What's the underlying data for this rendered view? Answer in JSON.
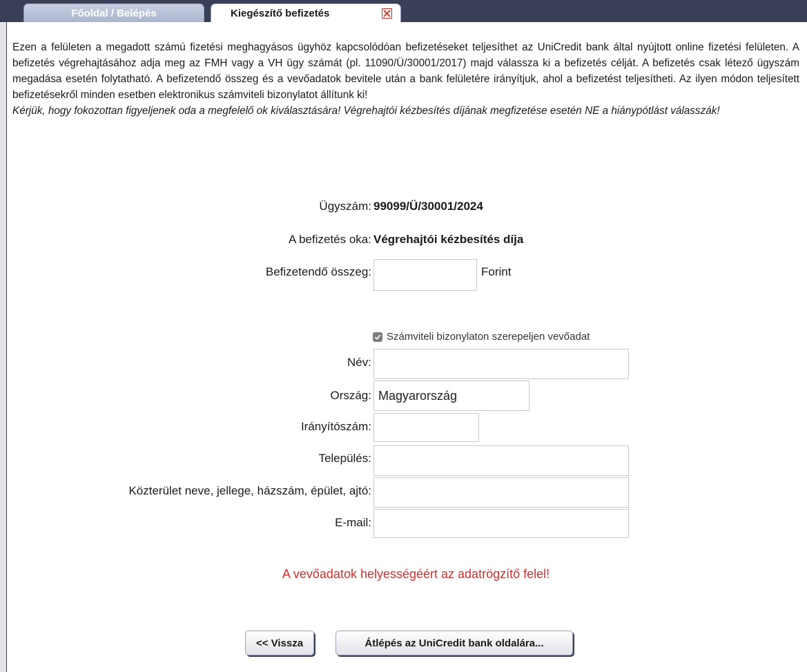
{
  "tabs": [
    {
      "label": "Főoldal / Belépés",
      "active": false
    },
    {
      "label": "Kiegészítő befizetés",
      "active": true
    }
  ],
  "intro": {
    "paragraph": "Ezen a felületen a megadott számú fizetési meghagyásos ügyhöz kapcsolódóan befizetéseket teljesíthet az UniCredit bank által nyújtott online fizetési felületen. A befizetés végrehajtásához adja meg az FMH vagy a VH ügy számát (pl. 11090/Ü/30001/2017) majd válassza ki a befizetés célját. A befizetés csak létező ügyszám megadása esetén folytatható. A befizetendő összeg és a vevőadatok bevitele után a bank felületére irányítjuk, ahol a befizetést teljesítheti. Az ilyen módon teljesített befizetésekről minden esetben elektronikus számviteli bizonylatot állítunk ki!",
    "warning": "Kérjük, hogy fokozottan figyeljenek oda a megfelelő ok kiválasztására! Végrehajtói kézbesítés díjának megfizetése esetén NE a hiánypótlást válasszák!"
  },
  "case": {
    "number_label": "Ügyszám:",
    "number_value": "99099/Ü/30001/2024",
    "reason_label": "A befizetés oka:",
    "reason_value": "Végrehajtói kézbesítés díja"
  },
  "amount": {
    "label": "Befizetendő összeg:",
    "value": "",
    "unit": "Forint"
  },
  "buyer_checkbox": {
    "label": "Számviteli bizonylaton szerepeljen vevőadat",
    "checked": true
  },
  "fields": {
    "name": {
      "label": "Név:",
      "value": ""
    },
    "country": {
      "label": "Ország:",
      "value": "Magyarország"
    },
    "zip": {
      "label": "Irányítószám:",
      "value": ""
    },
    "city": {
      "label": "Település:",
      "value": ""
    },
    "street": {
      "label": "Közterület neve, jellege, házszám, épület, ajtó:",
      "value": ""
    },
    "email": {
      "label": "E-mail:",
      "value": ""
    }
  },
  "notice": "A vevőadatok helyességéért az adatrögzítő felel!",
  "buttons": {
    "back": "<< Vissza",
    "proceed": "Átlépés az UniCredit bank oldalára..."
  },
  "colors": {
    "tab_bar": "#3a3f58",
    "notice": "#d32f2f",
    "close_icon": "#c0392b"
  }
}
